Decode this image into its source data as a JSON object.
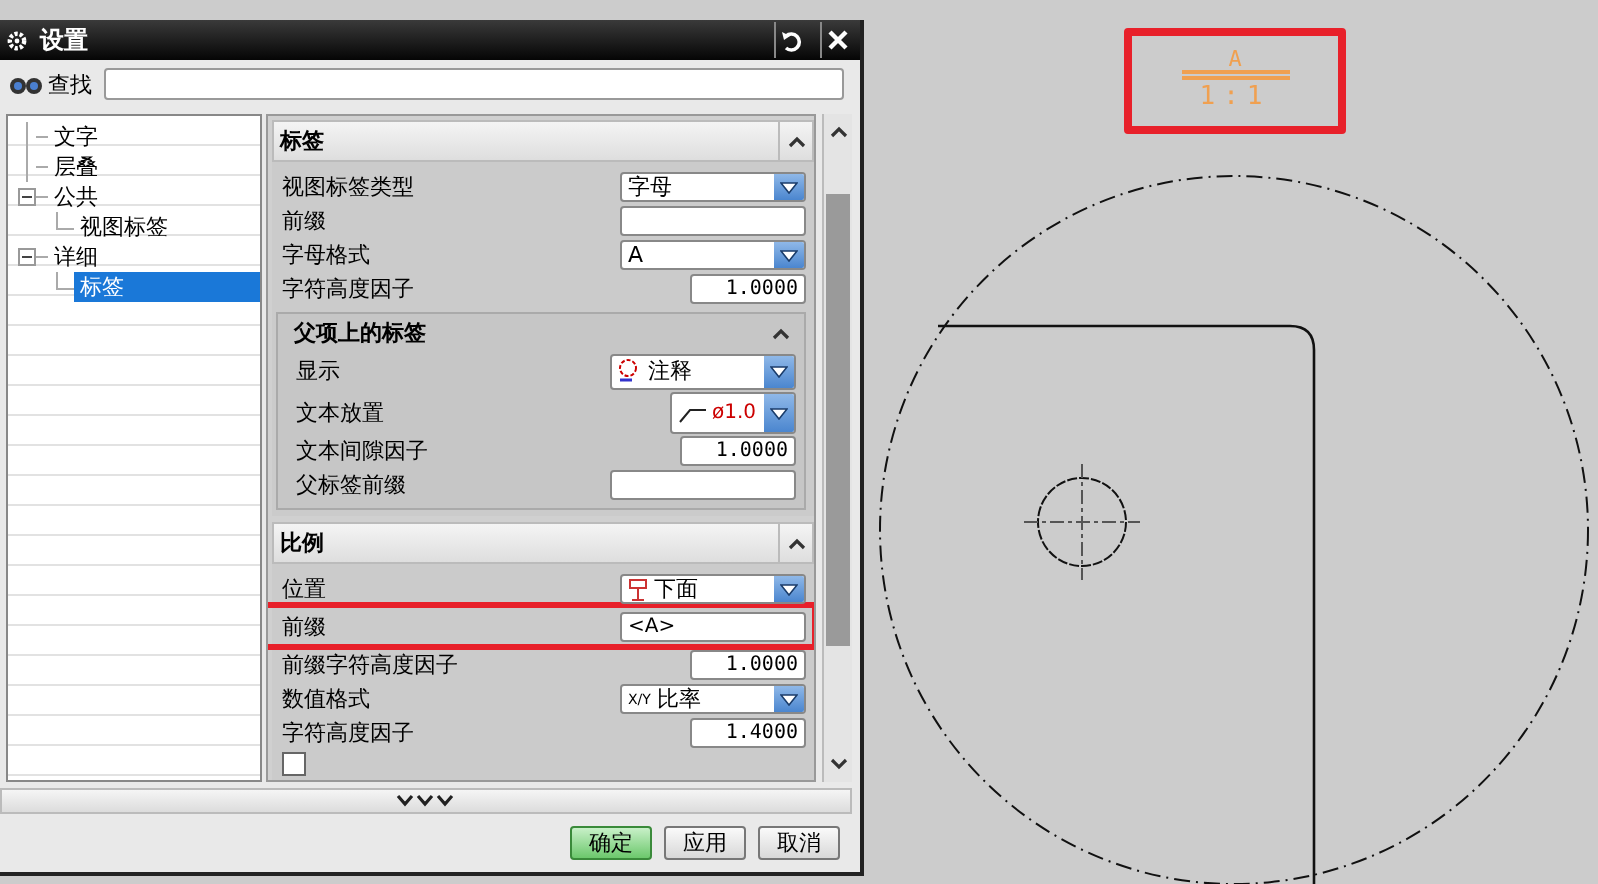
{
  "dialog": {
    "title": "设置"
  },
  "search": {
    "label": "查找"
  },
  "tree": [
    {
      "label": "文字",
      "selected": false
    },
    {
      "label": "层叠",
      "selected": false
    },
    {
      "label": "公共",
      "selected": false,
      "expanded": true,
      "children": [
        {
          "label": "视图标签",
          "selected": false
        }
      ]
    },
    {
      "label": "详细",
      "selected": false,
      "expanded": true,
      "children": [
        {
          "label": "标签",
          "selected": true
        }
      ]
    }
  ],
  "sections": [
    {
      "title": "标签",
      "expanded": true,
      "rows": [
        {
          "kind": "dropdown",
          "label": "视图标签类型",
          "value": "字母",
          "highlighted": false
        },
        {
          "kind": "text",
          "label": "前缀",
          "highlighted": false
        },
        {
          "kind": "dropdown",
          "label": "字母格式",
          "value": "A",
          "highlighted": false
        },
        {
          "kind": "number",
          "label": "字符高度因子",
          "value": "1.0000",
          "highlighted": false
        }
      ],
      "subsections": [
        {
          "title": "父项上的标签",
          "expanded": true,
          "rows": [
            {
              "kind": "dropdown",
              "label": "显示",
              "value": "注释",
              "highlighted": false
            },
            {
              "kind": "dropdown",
              "label": "文本放置",
              "value": "ø1.0",
              "highlighted": false
            },
            {
              "kind": "number",
              "label": "文本间隙因子",
              "value": "1.0000",
              "highlighted": false
            },
            {
              "kind": "text",
              "label": "父标签前缀",
              "highlighted": false
            }
          ]
        }
      ]
    },
    {
      "title": "比例",
      "expanded": true,
      "rows": [
        {
          "kind": "dropdown",
          "label": "位置",
          "value": "下面",
          "highlighted": false
        },
        {
          "kind": "text",
          "label": "前缀",
          "value": "<A>",
          "highlighted": true
        },
        {
          "kind": "number",
          "label": "前缀字符高度因子",
          "value": "1.0000",
          "highlighted": false
        },
        {
          "kind": "dropdown",
          "label": "数值格式",
          "prefix": "X/Y",
          "value": "比率",
          "highlighted": false
        },
        {
          "kind": "number",
          "label": "字符高度因子",
          "value": "1.4000",
          "highlighted": false
        },
        {
          "kind": "checkbox",
          "checked": false,
          "highlighted": false
        }
      ]
    }
  ],
  "buttons": [
    {
      "label": "确定",
      "default": true
    },
    {
      "label": "应用",
      "default": false
    },
    {
      "label": "取消",
      "default": false
    }
  ],
  "canvas": {
    "view_label": {
      "letter": "A",
      "scale": "1:1",
      "highlighted": true
    }
  }
}
